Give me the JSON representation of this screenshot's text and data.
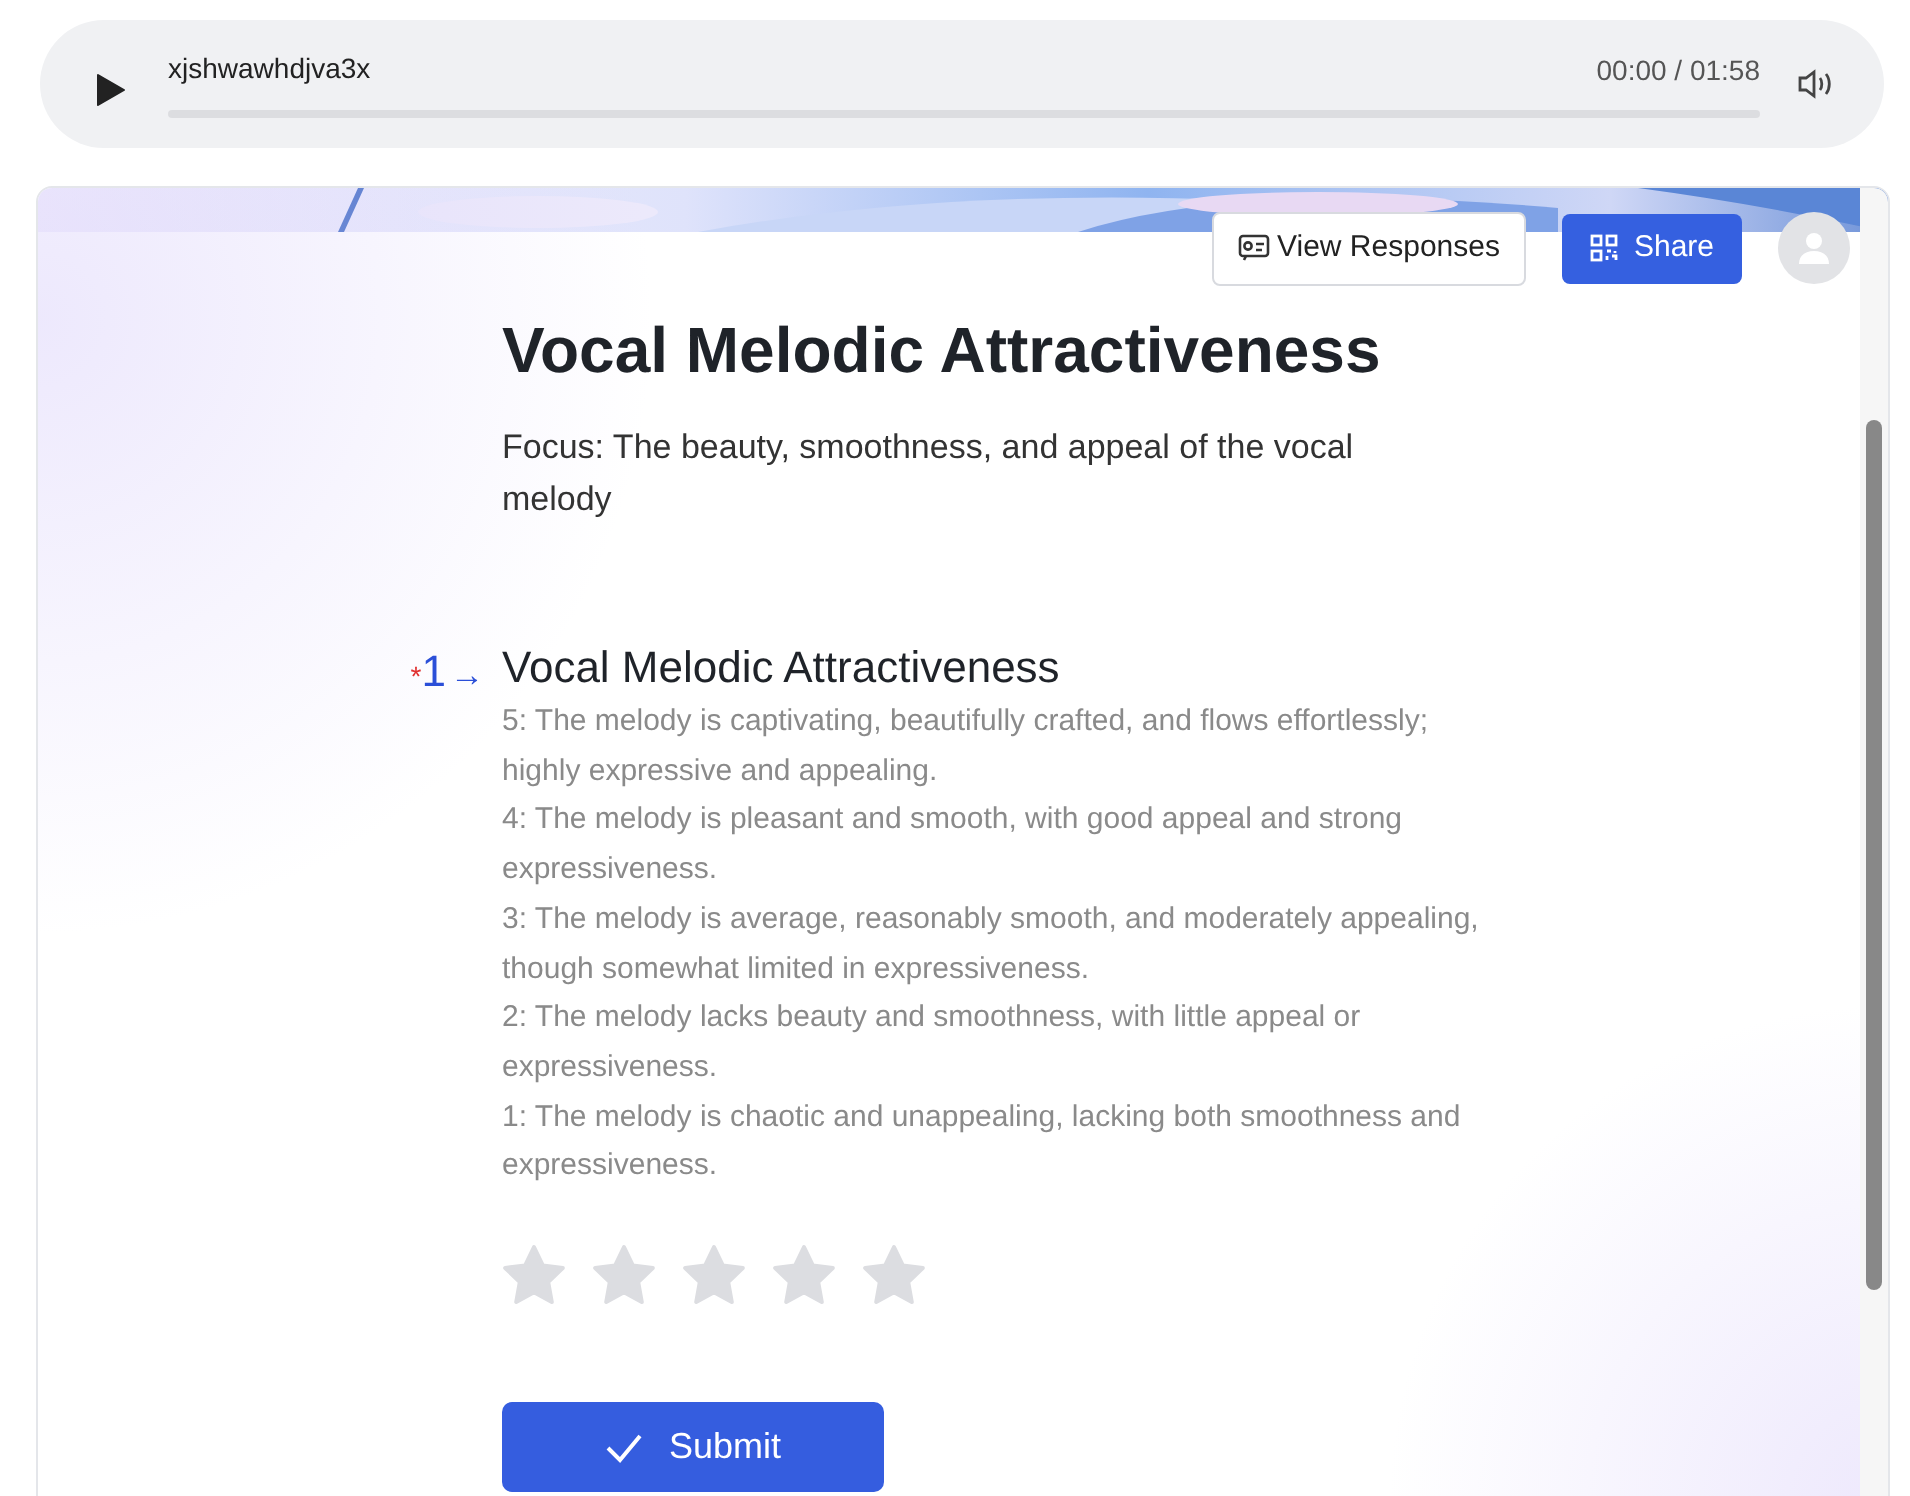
{
  "player": {
    "playing": false,
    "track": "xjshwawhdjva3x",
    "time": "00:00 / 01:58"
  },
  "toolbar": {
    "view_responses": "View Responses",
    "share": "Share"
  },
  "form": {
    "title": "Vocal Melodic Attractiveness",
    "description": "Focus: The beauty, smoothness, and appeal of the vocal melody"
  },
  "questions": [
    {
      "required_mark": "*",
      "number": "1",
      "arrow": "→",
      "title": "Vocal Melodic Attractiveness",
      "criteria": [
        "5: The melody is captivating, beautifully crafted, and flows effortlessly; highly expressive and appealing.",
        "4: The melody is pleasant and smooth, with good appeal and strong expressiveness.",
        "3: The melody is average, reasonably smooth, and moderately appealing, though somewhat limited in expressiveness.",
        "2: The melody lacks beauty and smoothness, with little appeal or expressiveness.",
        "1: The melody is chaotic and unappealing, lacking both smoothness and expressiveness."
      ],
      "stars": 0
    }
  ],
  "submit": "Submit"
}
